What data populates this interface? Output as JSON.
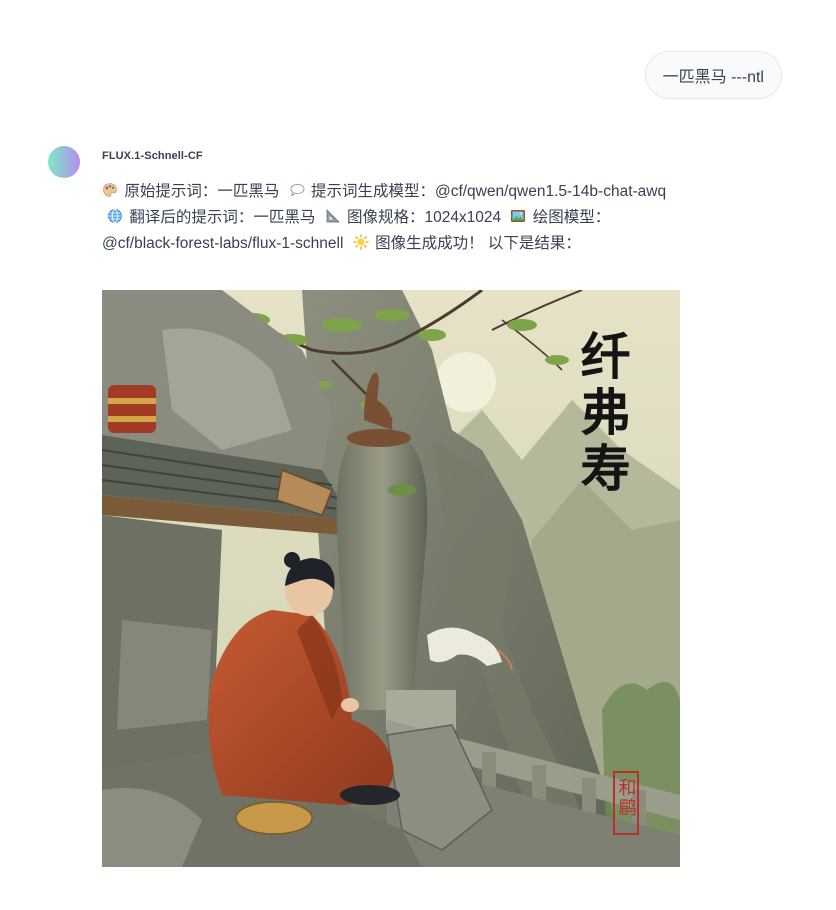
{
  "user_message": {
    "text": "一匹黑马 ---ntl"
  },
  "assistant": {
    "model_name": "FLUX.1-Schnell-CF",
    "segments": {
      "original_prompt": "原始提示词：一匹黑马",
      "prompt_model": "提示词生成模型：@cf/qwen/qwen1.5-14b-chat-awq",
      "translated_prompt": "翻译后的提示词：一匹黑马",
      "image_size": "图像规格：1024x1024",
      "draw_model": "绘图模型：@cf/black-forest-labs/flux-1-schnell",
      "success": "图像生成成功！ 以下是结果："
    },
    "icons": {
      "original_prompt": "palette-icon",
      "prompt_model": "speech-bubble-icon",
      "translated_prompt": "globe-icon",
      "image_size": "triangle-ruler-icon",
      "draw_model": "framed-picture-icon",
      "success": "sun-icon"
    },
    "image": {
      "calligraphy_text": "纤弗寿",
      "seal_text": "和鹛"
    }
  }
}
